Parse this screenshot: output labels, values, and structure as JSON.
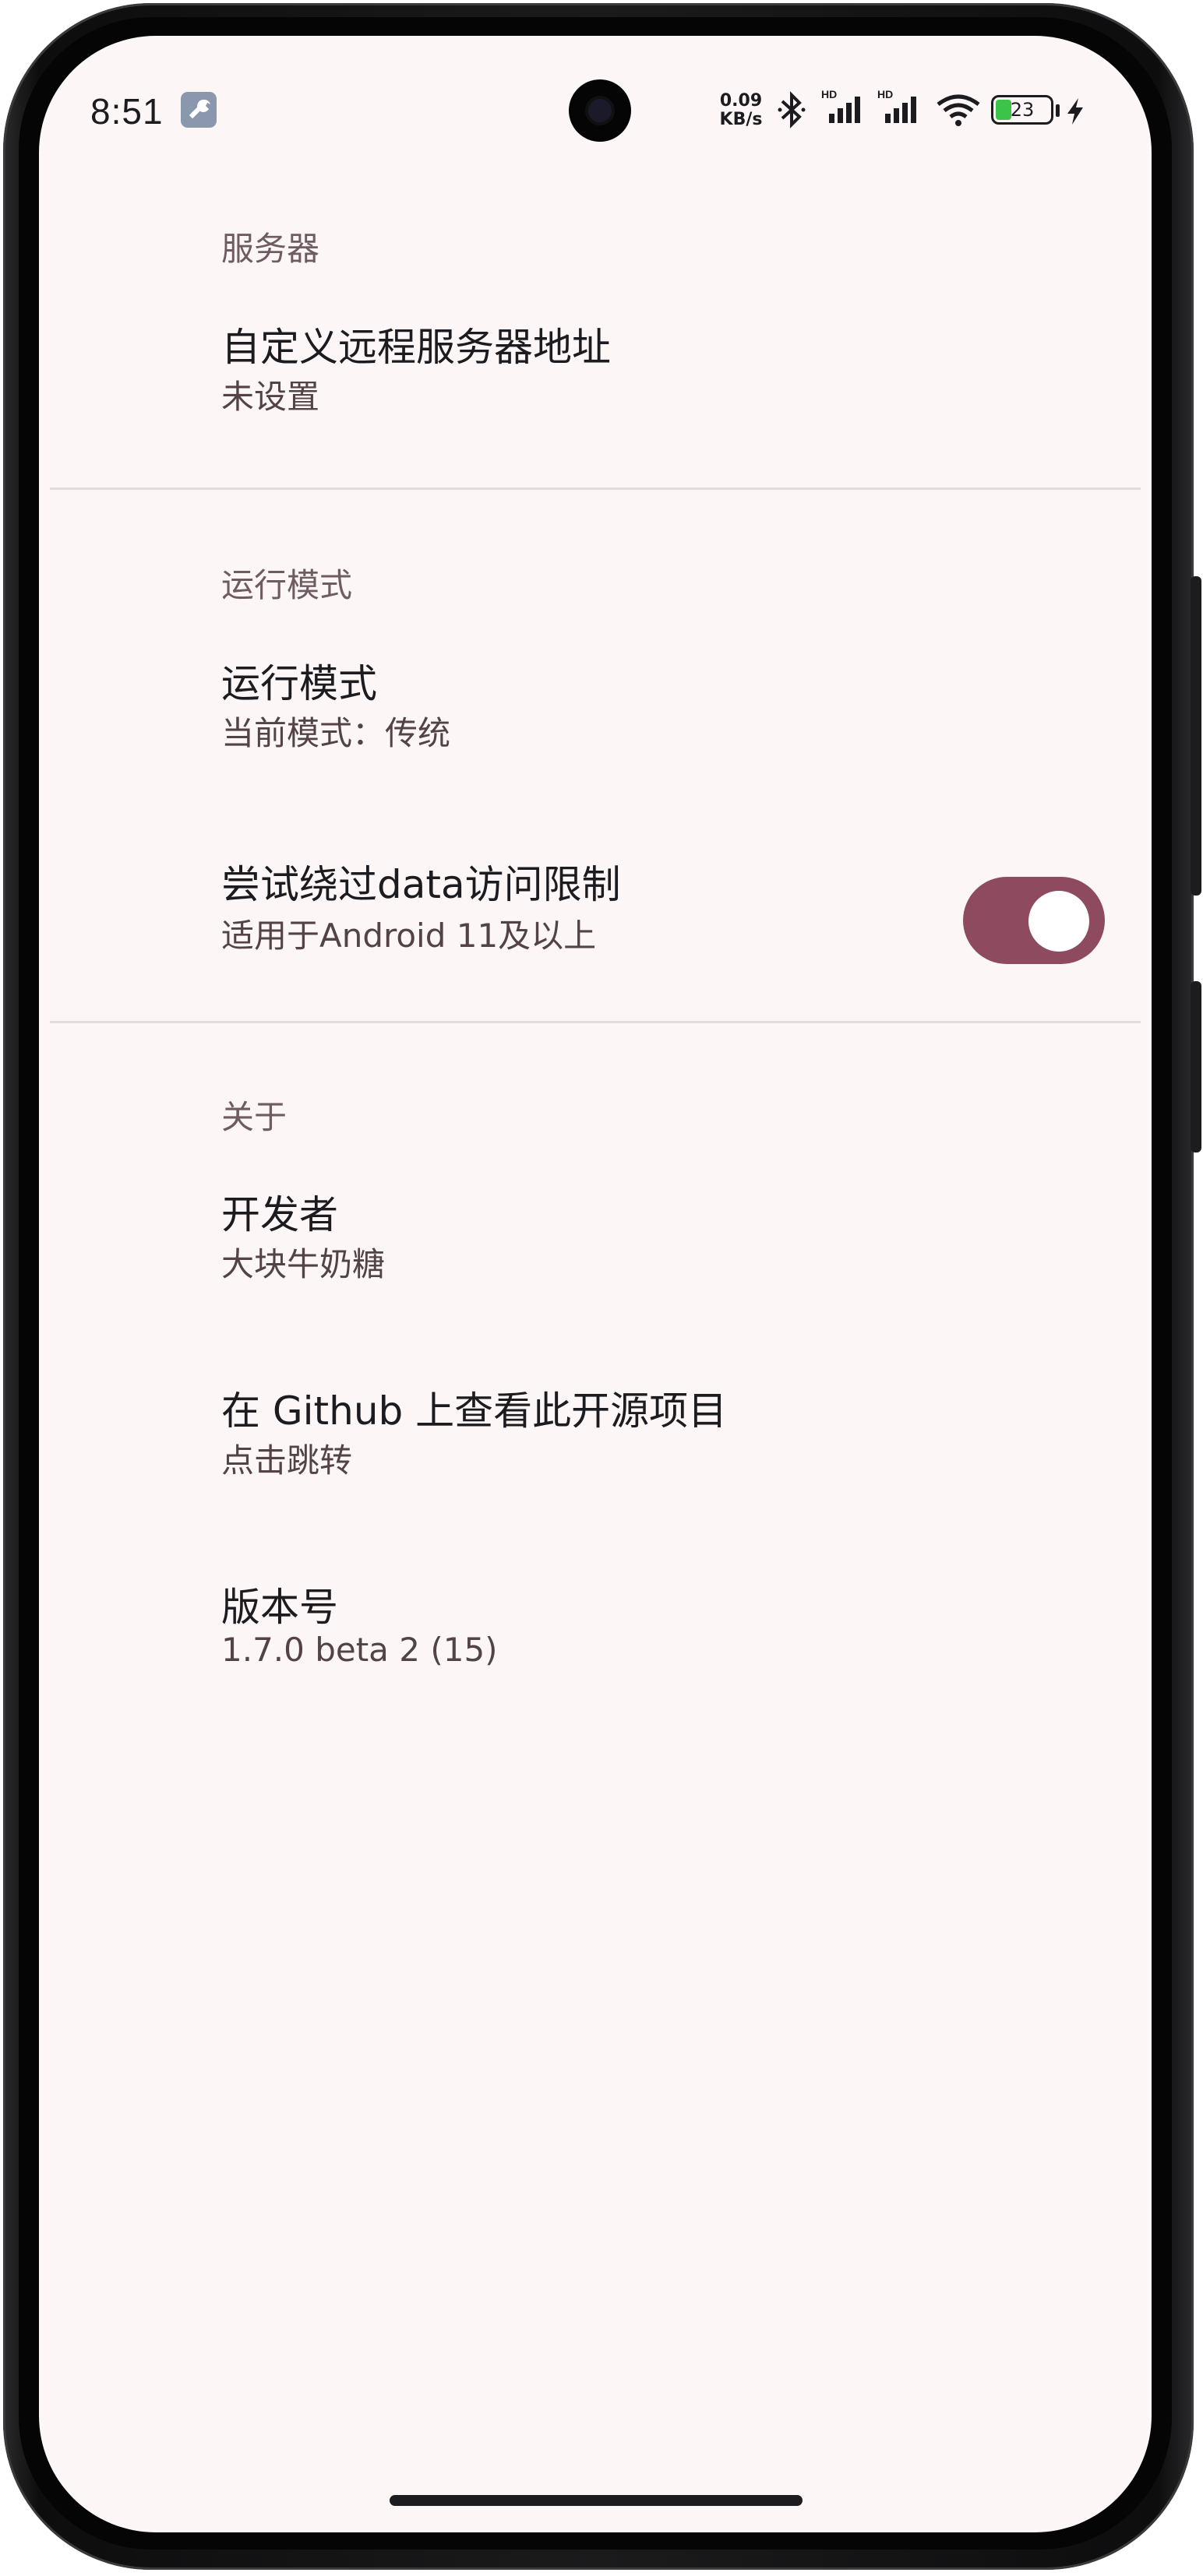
{
  "status_bar": {
    "time": "8:51",
    "net_speed_value": "0.09",
    "net_speed_unit": "KB/s",
    "battery_level": "23",
    "icons": [
      "wrench-icon",
      "bluetooth-icon",
      "signal-hd-icon",
      "signal-hd-icon",
      "wifi-icon",
      "battery-icon",
      "charging-icon"
    ]
  },
  "sections": {
    "server": {
      "header": "服务器",
      "items": [
        {
          "title": "自定义远程服务器地址",
          "subtitle": "未设置"
        }
      ]
    },
    "run_mode": {
      "header": "运行模式",
      "items": [
        {
          "title": "运行模式",
          "subtitle": "当前模式：传统"
        },
        {
          "title": "尝试绕过data访问限制",
          "subtitle": "适用于Android 11及以上",
          "toggle_on": true
        }
      ]
    },
    "about": {
      "header": "关于",
      "items": [
        {
          "title": "开发者",
          "subtitle": "大块牛奶糖"
        },
        {
          "title": "在 Github 上查看此开源项目",
          "subtitle": "点击跳转"
        },
        {
          "title": "版本号",
          "subtitle": "1.7.0 beta 2 (15)"
        }
      ]
    }
  },
  "colors": {
    "background": "#fcf7f6",
    "accent": "#8e4a5e",
    "header_text": "#6f5b62",
    "title_text": "#1c1b1f",
    "subtitle_text": "#534347"
  }
}
